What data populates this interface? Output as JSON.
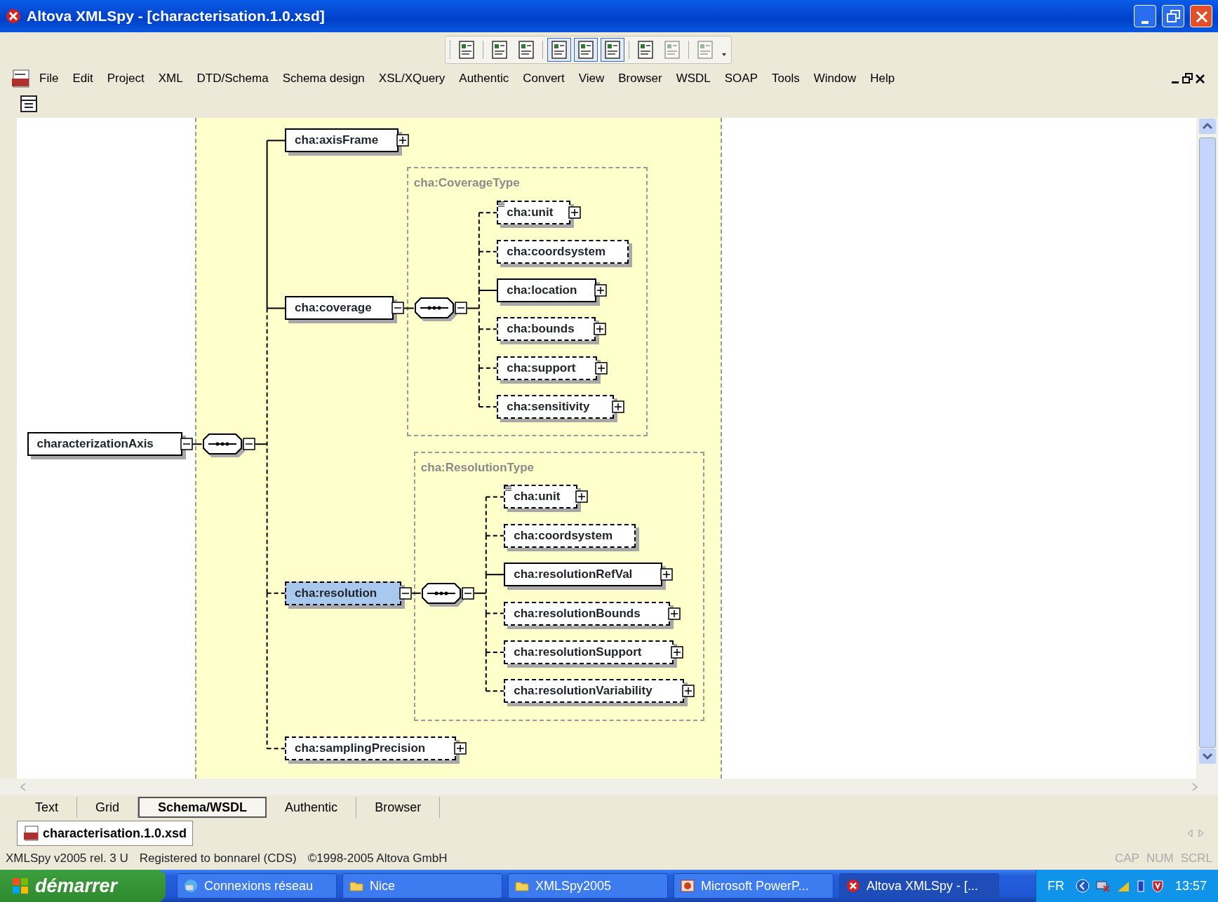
{
  "window": {
    "title": "Altova XMLSpy - [characterisation.1.0.xsd]"
  },
  "toolbar": [
    {
      "pressed": false,
      "disabled": false
    },
    {
      "pressed": false,
      "disabled": false
    },
    {
      "pressed": false,
      "disabled": false
    },
    {
      "pressed": true,
      "disabled": false
    },
    {
      "pressed": true,
      "disabled": false
    },
    {
      "pressed": true,
      "disabled": false
    },
    {
      "pressed": false,
      "disabled": false
    },
    {
      "pressed": false,
      "disabled": true
    },
    {
      "pressed": false,
      "disabled": true
    }
  ],
  "menu": [
    "File",
    "Edit",
    "Project",
    "XML",
    "DTD/Schema",
    "Schema design",
    "XSL/XQuery",
    "Authentic",
    "Convert",
    "View",
    "Browser",
    "WSDL",
    "SOAP",
    "Tools",
    "Window",
    "Help"
  ],
  "diagram": {
    "root": {
      "name": "characterizationAxis",
      "optional": false,
      "selected": false,
      "expanded": true,
      "children": [
        {
          "name": "cha:axisFrame",
          "optional": false,
          "selected": false,
          "expanded": false
        },
        {
          "name": "cha:coverage",
          "optional": false,
          "selected": false,
          "expanded": true,
          "type_name": "cha:CoverageType",
          "children": [
            {
              "name": "cha:unit",
              "optional": true,
              "selected": false,
              "annotated": true,
              "expanded": false
            },
            {
              "name": "cha:coordsystem",
              "optional": true,
              "selected": false
            },
            {
              "name": "cha:location",
              "optional": false,
              "selected": false,
              "expanded": false
            },
            {
              "name": "cha:bounds",
              "optional": true,
              "selected": false,
              "expanded": false
            },
            {
              "name": "cha:support",
              "optional": true,
              "selected": false,
              "expanded": false
            },
            {
              "name": "cha:sensitivity",
              "optional": true,
              "selected": false,
              "expanded": false
            }
          ]
        },
        {
          "name": "cha:resolution",
          "optional": true,
          "selected": true,
          "expanded": true,
          "type_name": "cha:ResolutionType",
          "children": [
            {
              "name": "cha:unit",
              "optional": true,
              "selected": false,
              "annotated": true,
              "expanded": false
            },
            {
              "name": "cha:coordsystem",
              "optional": true,
              "selected": false
            },
            {
              "name": "cha:resolutionRefVal",
              "optional": false,
              "selected": false,
              "expanded": false
            },
            {
              "name": "cha:resolutionBounds",
              "optional": true,
              "selected": false,
              "expanded": false
            },
            {
              "name": "cha:resolutionSupport",
              "optional": true,
              "selected": false,
              "expanded": false
            },
            {
              "name": "cha:resolutionVariability",
              "optional": true,
              "selected": false,
              "expanded": false
            }
          ]
        },
        {
          "name": "cha:samplingPrecision",
          "optional": true,
          "selected": false,
          "expanded": false
        }
      ]
    }
  },
  "view_tabs": [
    {
      "label": "Text",
      "selected": false
    },
    {
      "label": "Grid",
      "selected": false
    },
    {
      "label": "Schema/WSDL",
      "selected": true
    },
    {
      "label": "Authentic",
      "selected": false
    },
    {
      "label": "Browser",
      "selected": false
    }
  ],
  "document_tab": "characterisation.1.0.xsd",
  "status_bar": {
    "texts": [
      "XMLSpy v2005 rel. 3 U",
      "Registered to bonnarel (CDS)",
      "©1998-2005 Altova GmbH"
    ],
    "indicators": [
      {
        "label": "CAP",
        "on": false
      },
      {
        "label": "NUM",
        "on": false
      },
      {
        "label": "SCRL",
        "on": false
      }
    ]
  },
  "taskbar": {
    "start": "démarrer",
    "tasks": [
      {
        "label": "Connexions réseau",
        "kind": "network",
        "selected": false
      },
      {
        "label": "Nice",
        "kind": "folder",
        "selected": false
      },
      {
        "label": "XMLSpy2005",
        "kind": "folder",
        "selected": false
      },
      {
        "label": "Microsoft PowerP...",
        "kind": "powerpoint",
        "selected": false
      },
      {
        "label": "Altova XMLSpy - [...",
        "kind": "xmlspy",
        "selected": true
      }
    ],
    "language": "FR",
    "clock": "13:57"
  }
}
